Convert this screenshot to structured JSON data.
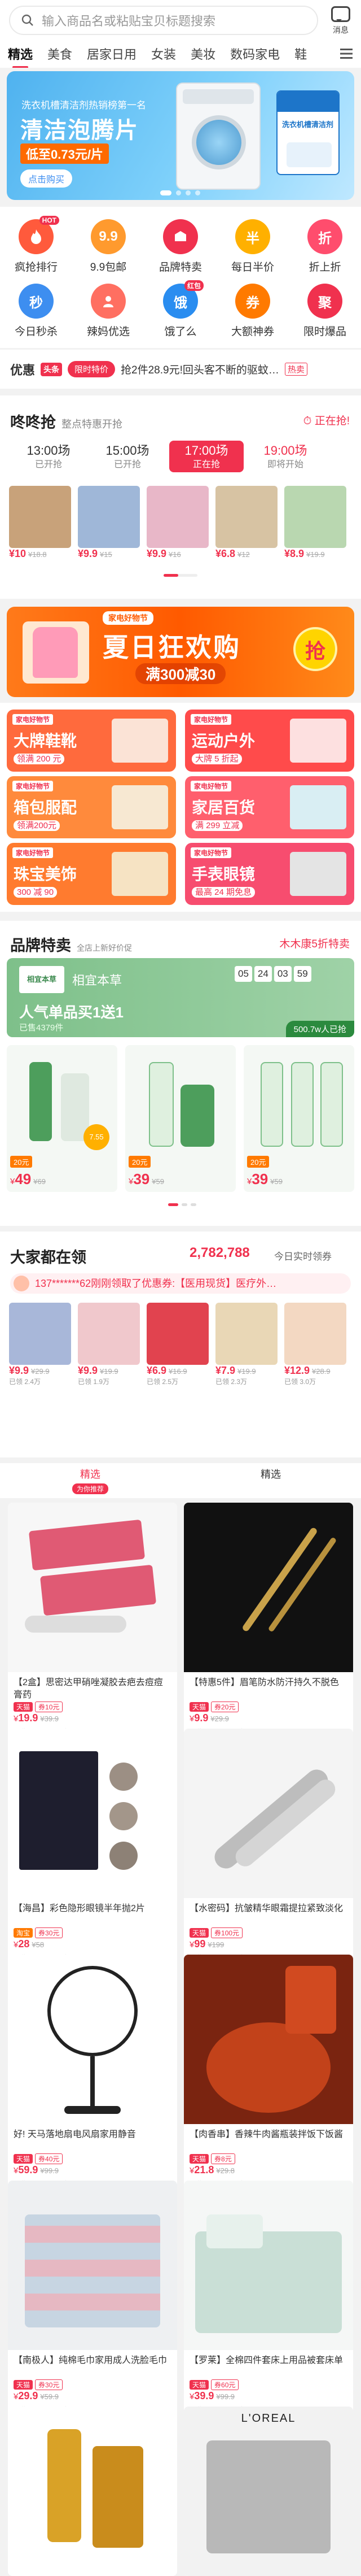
{
  "search": {
    "placeholder": "输入商品名或粘贴宝贝标题搜索"
  },
  "message": {
    "label": "消息"
  },
  "categories": [
    "精选",
    "美食",
    "居家日用",
    "女装",
    "美妆",
    "数码家电",
    "鞋"
  ],
  "banner": {
    "line1": "洗衣机槽清洁剂热销榜第一名",
    "title": "清洁泡腾片",
    "price": "低至0.73元/片",
    "cta": "点击购买",
    "pack_text": "洗衣机槽清洁剂"
  },
  "icons": [
    {
      "label": "疯抢排行",
      "icon": "fire-icon",
      "color": "#ff5a3c",
      "tag": "HOT"
    },
    {
      "label": "9.9包邮",
      "icon": "nine-nine-icon",
      "color": "#ff9a2e",
      "badge": "9.9"
    },
    {
      "label": "品牌特卖",
      "icon": "brand-icon",
      "color": "#f0314e"
    },
    {
      "label": "每日半价",
      "icon": "half-price-icon",
      "color": "#ffb000",
      "badge": "半"
    },
    {
      "label": "折上折",
      "icon": "discount-icon",
      "color": "#ff4d6d",
      "badge": "折"
    },
    {
      "label": "今日秒杀",
      "icon": "flash-sale-icon",
      "color": "#3d8ef0",
      "badge": "秒"
    },
    {
      "label": "辣妈优选",
      "icon": "mom-icon",
      "color": "#ff6f61"
    },
    {
      "label": "饿了么",
      "icon": "eleme-icon",
      "color": "#2a8df0",
      "tag": "红包",
      "badge": "饿"
    },
    {
      "label": "大额神券",
      "icon": "coupon-icon",
      "color": "#ff7a00",
      "badge": "券"
    },
    {
      "label": "限时爆品",
      "icon": "hot-item-icon",
      "color": "#f0314e",
      "badge": "聚"
    }
  ],
  "headline": {
    "brand": "优惠",
    "tag": "头条",
    "pill": "限时特价",
    "text": "抢2件28.9元!回头客不断的驱蚊…",
    "trail": "热卖"
  },
  "flash": {
    "title": "咚咚抢",
    "subtitle": "整点特惠开抢",
    "status": "正在抢!",
    "tabs": [
      {
        "time": "13:00场",
        "state": "已开抢"
      },
      {
        "time": "15:00场",
        "state": "已开抢"
      },
      {
        "time": "17:00场",
        "state": "正在抢"
      },
      {
        "time": "19:00场",
        "state": "即将开始"
      }
    ],
    "items": [
      {
        "price": "¥10",
        "orig": "¥18.8",
        "color": "#c8a27a"
      },
      {
        "price": "¥9.9",
        "orig": "¥15",
        "color": "#9fb7d8"
      },
      {
        "price": "¥9.9",
        "orig": "¥16",
        "color": "#e8b7c8"
      },
      {
        "price": "¥6.8",
        "orig": "¥12",
        "color": "#d7c3a3"
      },
      {
        "price": "¥8.9",
        "orig": "¥19.9",
        "color": "#b9d7b0"
      }
    ]
  },
  "summer": {
    "badge": "家电好物节",
    "title": "夏日狂欢购",
    "subtitle": "满300减30",
    "button": "抢"
  },
  "promos": [
    {
      "title": "大牌鞋靴",
      "sub": "领满 200 元",
      "badge": "家电好物节",
      "color": "#ff6a3d"
    },
    {
      "title": "运动户外",
      "sub": "大牌 5 折起",
      "badge": "家电好物节",
      "color": "#ff4b4b"
    },
    {
      "title": "箱包服配",
      "sub": "领满200元",
      "badge": "家电好物节",
      "color": "#ff8a3c"
    },
    {
      "title": "家居百货",
      "sub": "满 299 立减",
      "badge": "家电好物节",
      "color": "#ff5f6d"
    },
    {
      "title": "珠宝美饰",
      "sub": "300 减 90",
      "badge": "家电好物节",
      "color": "#ff7b2f"
    },
    {
      "title": "手表眼镜",
      "sub": "最高 24 期免息",
      "badge": "家电好物节",
      "color": "#f74d6f"
    }
  ],
  "brand_sale": {
    "title": "品牌特卖",
    "subtitle": "全店上新好价促",
    "link": "木木康5折特卖",
    "brand_name": "相宜本草",
    "brand_logo_text": "相宜本草",
    "headline": "人气单品买1送1",
    "sold": "已售4379件",
    "discount_pill": "500.7w人已抢",
    "countdown": [
      "05",
      "24",
      "03",
      "59"
    ],
    "products": [
      {
        "price": "49",
        "orig": "69",
        "tag": "20元",
        "gift": "7.55"
      },
      {
        "price": "39",
        "orig": "59",
        "tag": "20元"
      },
      {
        "price": "39",
        "orig": "59",
        "tag": "20元"
      }
    ]
  },
  "everyone": {
    "title": "大家都在领",
    "count": "2,782,788",
    "count_suffix": "今日实时领券",
    "ticker": "137*******62刚刚领取了优惠券:【医用现货】医疗外…",
    "items": [
      {
        "price": "¥9.9",
        "orig": "¥29.9",
        "note": "已领 2.4万"
      },
      {
        "price": "¥9.9",
        "orig": "¥19.9",
        "note": "已领 1.9万"
      },
      {
        "price": "¥6.9",
        "orig": "¥16.9",
        "note": "已领 2.5万"
      },
      {
        "price": "¥7.9",
        "orig": "¥19.9",
        "note": "已领 2.3万"
      },
      {
        "price": "¥12.9",
        "orig": "¥28.9",
        "note": "已领 3.0万"
      }
    ]
  },
  "feed_tabs": [
    {
      "label": "精选",
      "sub": "为你推荐"
    },
    {
      "label": "精选",
      "sub": ""
    }
  ],
  "feed": [
    {
      "title": "【2盒】思密达甲硝唑凝胶去疤去痘痘膏药",
      "price": "19.9",
      "orig": "¥39.9",
      "chip": "天猫",
      "coupon": "券10元",
      "meta": "已售 1.4万 | 评论 5.1万"
    },
    {
      "title": "【特惠5件】眉笔防水防汗持久不脱色",
      "price": "9.9",
      "orig": "¥29.9",
      "chip": "天猫",
      "coupon": "券20元",
      "meta": "已售 9.8万 | 评论 1.4万"
    },
    {
      "title": "【海昌】彩色隐形眼镜半年抛2片",
      "price": "28",
      "orig": "¥58",
      "chip": "淘宝",
      "coupon": "券30元",
      "meta": "已售 1.3万 | 评论 3.6万"
    },
    {
      "title": "【水密码】抗皱精华眼霜提拉紧致淡化",
      "price": "99",
      "orig": "¥199",
      "chip": "天猫",
      "coupon": "券100元",
      "meta": "已售 5.4万 | 评论 2.1万"
    },
    {
      "title": "好! 天马落地扇电风扇家用静音",
      "price": "59.9",
      "orig": "¥99.9",
      "chip": "天猫",
      "coupon": "券40元",
      "meta": "已售 9.2万 | 评论 1.2万"
    },
    {
      "title": "【肉香串】香辣牛肉酱瓶装拌饭下饭酱",
      "price": "21.8",
      "orig": "¥29.8",
      "chip": "天猫",
      "coupon": "券8元",
      "meta": "已售 1.2万 | 评论 9.8万"
    },
    {
      "title": "【南极人】纯棉毛巾家用成人洗脸毛巾",
      "price": "29.9",
      "orig": "¥59.9",
      "chip": "天猫",
      "coupon": "券30元",
      "meta": "已售 1.1万 | 评论 1.6万"
    },
    {
      "title": "【罗莱】全棉四件套床上用品被套床单",
      "price": "39.9",
      "orig": "¥99.9",
      "chip": "天猫",
      "coupon": "券60元",
      "meta": "已售 5.6万 | 评论 2.3万"
    }
  ],
  "bottom_brand": "L'OREAL"
}
